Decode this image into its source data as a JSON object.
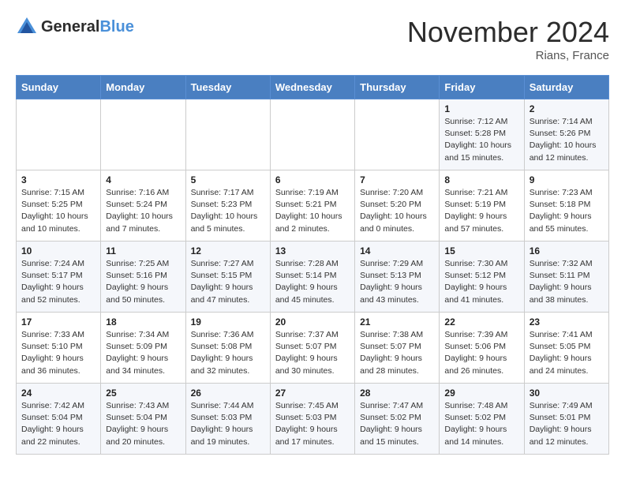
{
  "header": {
    "logo_line1": "General",
    "logo_line2": "Blue",
    "month_title": "November 2024",
    "location": "Rians, France"
  },
  "weekdays": [
    "Sunday",
    "Monday",
    "Tuesday",
    "Wednesday",
    "Thursday",
    "Friday",
    "Saturday"
  ],
  "weeks": [
    [
      {
        "day": "",
        "info": ""
      },
      {
        "day": "",
        "info": ""
      },
      {
        "day": "",
        "info": ""
      },
      {
        "day": "",
        "info": ""
      },
      {
        "day": "",
        "info": ""
      },
      {
        "day": "1",
        "info": "Sunrise: 7:12 AM\nSunset: 5:28 PM\nDaylight: 10 hours\nand 15 minutes."
      },
      {
        "day": "2",
        "info": "Sunrise: 7:14 AM\nSunset: 5:26 PM\nDaylight: 10 hours\nand 12 minutes."
      }
    ],
    [
      {
        "day": "3",
        "info": "Sunrise: 7:15 AM\nSunset: 5:25 PM\nDaylight: 10 hours\nand 10 minutes."
      },
      {
        "day": "4",
        "info": "Sunrise: 7:16 AM\nSunset: 5:24 PM\nDaylight: 10 hours\nand 7 minutes."
      },
      {
        "day": "5",
        "info": "Sunrise: 7:17 AM\nSunset: 5:23 PM\nDaylight: 10 hours\nand 5 minutes."
      },
      {
        "day": "6",
        "info": "Sunrise: 7:19 AM\nSunset: 5:21 PM\nDaylight: 10 hours\nand 2 minutes."
      },
      {
        "day": "7",
        "info": "Sunrise: 7:20 AM\nSunset: 5:20 PM\nDaylight: 10 hours\nand 0 minutes."
      },
      {
        "day": "8",
        "info": "Sunrise: 7:21 AM\nSunset: 5:19 PM\nDaylight: 9 hours\nand 57 minutes."
      },
      {
        "day": "9",
        "info": "Sunrise: 7:23 AM\nSunset: 5:18 PM\nDaylight: 9 hours\nand 55 minutes."
      }
    ],
    [
      {
        "day": "10",
        "info": "Sunrise: 7:24 AM\nSunset: 5:17 PM\nDaylight: 9 hours\nand 52 minutes."
      },
      {
        "day": "11",
        "info": "Sunrise: 7:25 AM\nSunset: 5:16 PM\nDaylight: 9 hours\nand 50 minutes."
      },
      {
        "day": "12",
        "info": "Sunrise: 7:27 AM\nSunset: 5:15 PM\nDaylight: 9 hours\nand 47 minutes."
      },
      {
        "day": "13",
        "info": "Sunrise: 7:28 AM\nSunset: 5:14 PM\nDaylight: 9 hours\nand 45 minutes."
      },
      {
        "day": "14",
        "info": "Sunrise: 7:29 AM\nSunset: 5:13 PM\nDaylight: 9 hours\nand 43 minutes."
      },
      {
        "day": "15",
        "info": "Sunrise: 7:30 AM\nSunset: 5:12 PM\nDaylight: 9 hours\nand 41 minutes."
      },
      {
        "day": "16",
        "info": "Sunrise: 7:32 AM\nSunset: 5:11 PM\nDaylight: 9 hours\nand 38 minutes."
      }
    ],
    [
      {
        "day": "17",
        "info": "Sunrise: 7:33 AM\nSunset: 5:10 PM\nDaylight: 9 hours\nand 36 minutes."
      },
      {
        "day": "18",
        "info": "Sunrise: 7:34 AM\nSunset: 5:09 PM\nDaylight: 9 hours\nand 34 minutes."
      },
      {
        "day": "19",
        "info": "Sunrise: 7:36 AM\nSunset: 5:08 PM\nDaylight: 9 hours\nand 32 minutes."
      },
      {
        "day": "20",
        "info": "Sunrise: 7:37 AM\nSunset: 5:07 PM\nDaylight: 9 hours\nand 30 minutes."
      },
      {
        "day": "21",
        "info": "Sunrise: 7:38 AM\nSunset: 5:07 PM\nDaylight: 9 hours\nand 28 minutes."
      },
      {
        "day": "22",
        "info": "Sunrise: 7:39 AM\nSunset: 5:06 PM\nDaylight: 9 hours\nand 26 minutes."
      },
      {
        "day": "23",
        "info": "Sunrise: 7:41 AM\nSunset: 5:05 PM\nDaylight: 9 hours\nand 24 minutes."
      }
    ],
    [
      {
        "day": "24",
        "info": "Sunrise: 7:42 AM\nSunset: 5:04 PM\nDaylight: 9 hours\nand 22 minutes."
      },
      {
        "day": "25",
        "info": "Sunrise: 7:43 AM\nSunset: 5:04 PM\nDaylight: 9 hours\nand 20 minutes."
      },
      {
        "day": "26",
        "info": "Sunrise: 7:44 AM\nSunset: 5:03 PM\nDaylight: 9 hours\nand 19 minutes."
      },
      {
        "day": "27",
        "info": "Sunrise: 7:45 AM\nSunset: 5:03 PM\nDaylight: 9 hours\nand 17 minutes."
      },
      {
        "day": "28",
        "info": "Sunrise: 7:47 AM\nSunset: 5:02 PM\nDaylight: 9 hours\nand 15 minutes."
      },
      {
        "day": "29",
        "info": "Sunrise: 7:48 AM\nSunset: 5:02 PM\nDaylight: 9 hours\nand 14 minutes."
      },
      {
        "day": "30",
        "info": "Sunrise: 7:49 AM\nSunset: 5:01 PM\nDaylight: 9 hours\nand 12 minutes."
      }
    ]
  ]
}
